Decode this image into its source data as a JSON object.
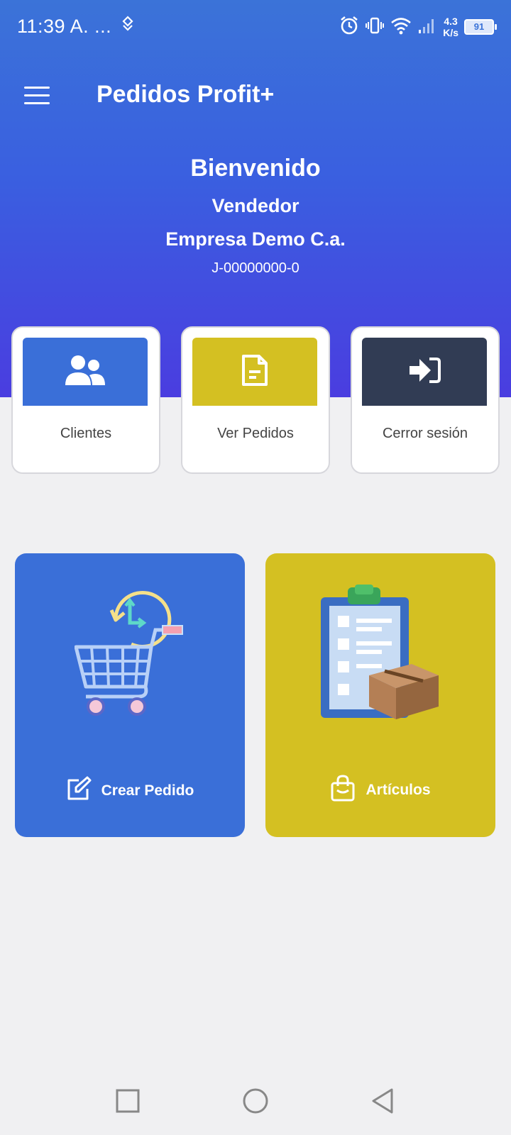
{
  "status_bar": {
    "time": "11:39 A. ...",
    "net_speed_value": "4.3",
    "net_speed_unit": "K/s",
    "battery": "91"
  },
  "app_bar": {
    "title": "Pedidos Profit+"
  },
  "welcome": {
    "title": "Bienvenido",
    "role": "Vendedor",
    "company": "Empresa Demo C.a.",
    "rif": "J-00000000-0"
  },
  "quick_actions": [
    {
      "label": "Clientes",
      "color": "#3a6fd8",
      "icon": "users-icon"
    },
    {
      "label": "Ver Pedidos",
      "color": "#d4c022",
      "icon": "document-icon"
    },
    {
      "label": "Cerror sesión",
      "color": "#313c54",
      "icon": "sign-in-icon"
    }
  ],
  "main_actions": [
    {
      "label": "Crear Pedido",
      "color": "#3a6fd8",
      "icon": "edit-icon"
    },
    {
      "label": "Artículos",
      "color": "#d4c022",
      "icon": "shopping-bag-icon"
    }
  ],
  "nav": [
    "recent-apps",
    "home",
    "back"
  ]
}
